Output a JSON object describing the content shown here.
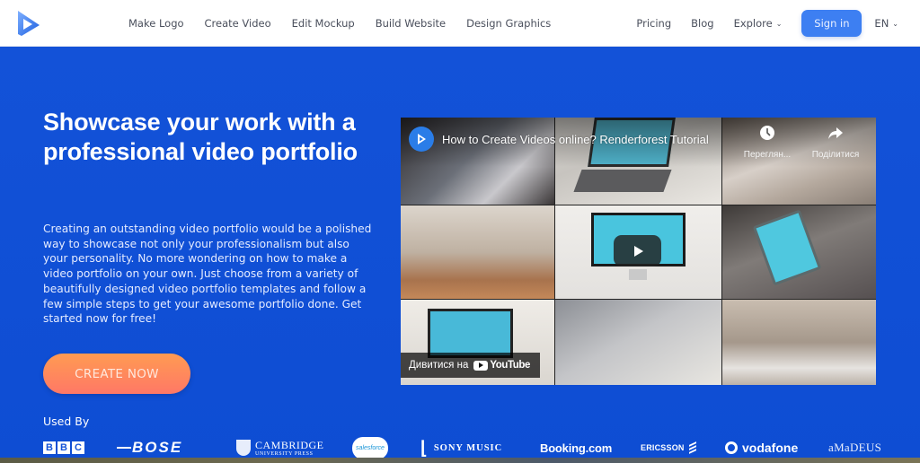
{
  "nav": {
    "logo_icon": "renderforest-play-logo-icon",
    "links": [
      "Make Logo",
      "Create Video",
      "Edit Mockup",
      "Build Website",
      "Design Graphics"
    ],
    "right_links": {
      "pricing": "Pricing",
      "blog": "Blog",
      "explore": "Explore"
    },
    "signin_label": "Sign in",
    "language": "EN"
  },
  "hero": {
    "headline": "Showcase your work with a professional video portfolio",
    "description": "Creating an outstanding video portfolio would be a polished way to showcase not only your professionalism but also your personality. No more wondering on how to make a video portfolio on your own. Just choose from a variety of beautifully designed video portfolio templates and follow a few simple steps to get your awesome portfolio done. Get started now for free!",
    "cta_label": "CREATE NOW",
    "used_by_label": "Used By"
  },
  "video": {
    "title": "How to Create Videos online? Renderforest Tutorial",
    "watch_later_label": "Переглян...",
    "share_label": "Поділитися",
    "watch_on_label": "Дивитися на",
    "youtube_label": "YouTube",
    "colors": {
      "play_button": "#212121",
      "channel_avatar": "#2a7de8"
    }
  },
  "logos": {
    "bbc": [
      "B",
      "B",
      "C"
    ],
    "bose": "BOSE",
    "cambridge_line1": "CAMBRIDGE",
    "cambridge_line2": "UNIVERSITY PRESS",
    "salesforce": "salesforce",
    "sony": "SONY MUSIC",
    "booking": "Booking.com",
    "ericsson": "ERICSSON",
    "vodafone": "vodafone",
    "amadeus": "aMaDEUS"
  },
  "colors": {
    "hero_bg": "#1352d8",
    "signin_bg": "#3d7ff2",
    "cta_gradient_top": "#ff9b52",
    "cta_gradient_bottom": "#ff7866",
    "nav_text": "#4a4f5c"
  }
}
